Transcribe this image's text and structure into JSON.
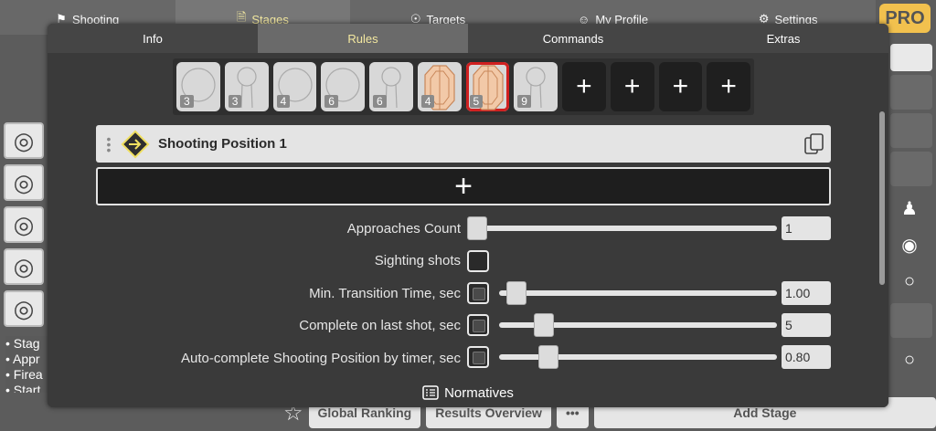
{
  "topnav": {
    "items": [
      {
        "label": "Shooting",
        "icon": "flag-icon"
      },
      {
        "label": "Stages",
        "icon": "document-icon"
      },
      {
        "label": "Targets",
        "icon": "target-icon"
      },
      {
        "label": "My Profile",
        "icon": "user-circle-icon"
      },
      {
        "label": "Settings",
        "icon": "gear-icon"
      }
    ],
    "active_index": 1,
    "pro_label": "PRO"
  },
  "background": {
    "left_list_lines": [
      "• Stag",
      "• Appr",
      "• Firea",
      "• Start"
    ],
    "bottom_buttons": [
      "Global Ranking",
      "Results Overview",
      "•••",
      "Add Stage"
    ]
  },
  "modal": {
    "tabs": [
      {
        "label": "Info"
      },
      {
        "label": "Rules"
      },
      {
        "label": "Commands"
      },
      {
        "label": "Extras"
      }
    ],
    "active_tab": 1,
    "targets": [
      {
        "type": "round",
        "count": "3"
      },
      {
        "type": "popper",
        "count": "3"
      },
      {
        "type": "round",
        "count": "4"
      },
      {
        "type": "round",
        "count": "6"
      },
      {
        "type": "popper",
        "count": "6"
      },
      {
        "type": "ipsc",
        "count": "4"
      },
      {
        "type": "ipsc",
        "count": "5",
        "selected": true
      },
      {
        "type": "popper",
        "count": "9"
      },
      {
        "type": "empty"
      },
      {
        "type": "empty"
      },
      {
        "type": "empty"
      },
      {
        "type": "empty"
      }
    ],
    "position_title": "Shooting Position 1",
    "settings": {
      "approaches_label": "Approaches Count",
      "approaches_value": "1",
      "sighting_label": "Sighting shots",
      "transition_label": "Min. Transition Time, sec",
      "transition_value": "1.00",
      "complete_label": "Complete on last shot, sec",
      "complete_value": "5",
      "autocomplete_label": "Auto-complete Shooting Position by timer, sec",
      "autocomplete_value": "0.80"
    },
    "footer_label": "Normatives"
  },
  "colors": {
    "accent_tab": "#f3e8a0",
    "selected_target": "#d02020",
    "pro_badge": "#f2c14e"
  }
}
